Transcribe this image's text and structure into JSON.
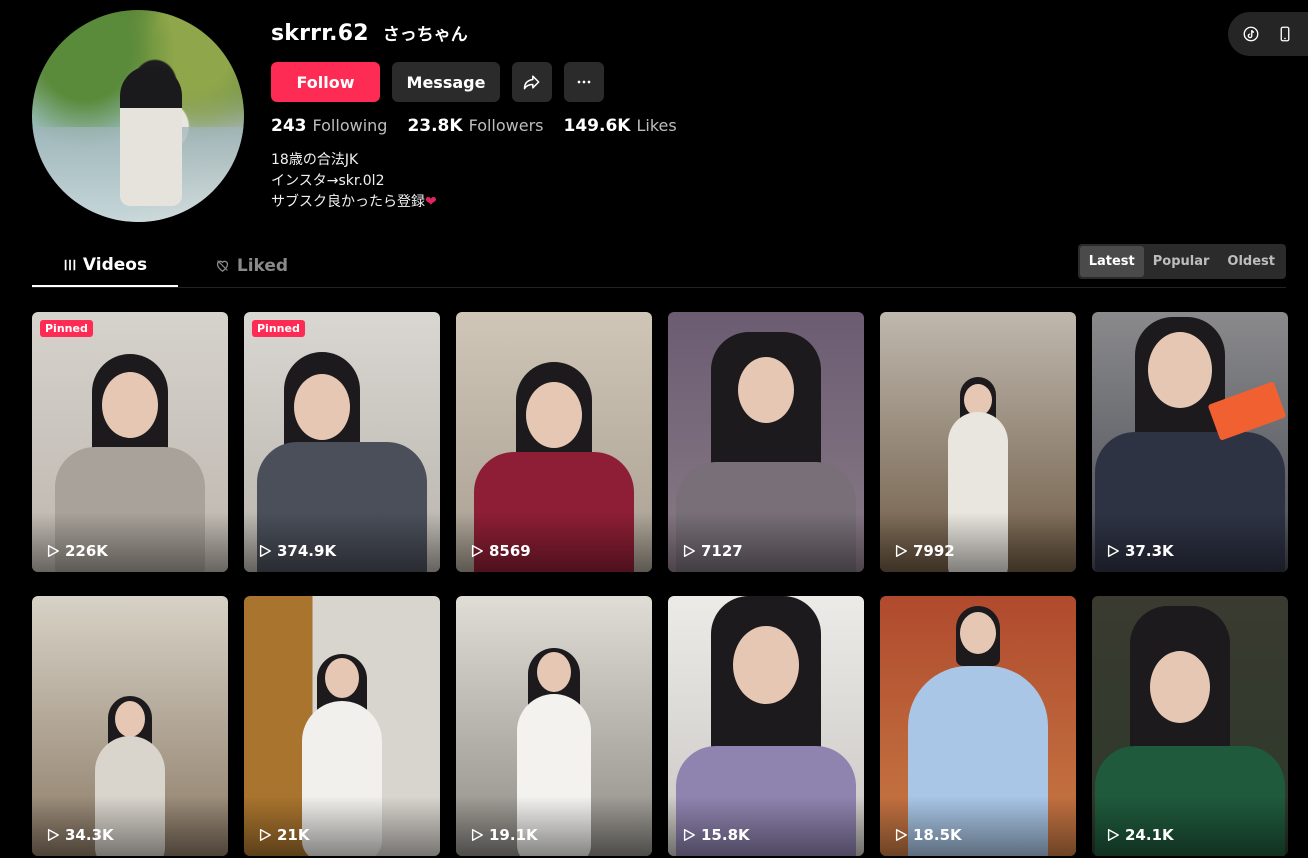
{
  "profile": {
    "username": "skrrr.62",
    "nickname": "さっちゃん",
    "follow_label": "Follow",
    "message_label": "Message",
    "stats": [
      {
        "value": "243",
        "label": "Following"
      },
      {
        "value": "23.8K",
        "label": "Followers"
      },
      {
        "value": "149.6K",
        "label": "Likes"
      }
    ],
    "bio": [
      "18歳の合法JK",
      "インスタ→skr.0l2",
      "サブスク良かったら登録"
    ],
    "bio_heart": "❤"
  },
  "tabs": {
    "videos": "Videos",
    "liked": "Liked"
  },
  "sort": {
    "options": [
      "Latest",
      "Popular",
      "Oldest"
    ],
    "selected": "Latest"
  },
  "videos": [
    {
      "views": "226K",
      "pinned": "Pinned"
    },
    {
      "views": "374.9K",
      "pinned": "Pinned"
    },
    {
      "views": "8569"
    },
    {
      "views": "7127"
    },
    {
      "views": "7992"
    },
    {
      "views": "37.3K"
    },
    {
      "views": "34.3K"
    },
    {
      "views": "21K"
    },
    {
      "views": "19.1K"
    },
    {
      "views": "15.8K"
    },
    {
      "views": "18.5K"
    },
    {
      "views": "24.1K"
    }
  ],
  "colors": {
    "accent": "#fe2c55",
    "background": "#000000",
    "button_dark": "#2b2b2b"
  },
  "icons": {
    "share": "share-arrow-icon",
    "more": "more-dots-icon",
    "videos_tab": "grid-bars-icon",
    "liked_tab": "heart-outline-icon",
    "views": "play-icon",
    "topright": [
      "tiktok-logo-icon",
      "mobile-device-icon"
    ]
  }
}
